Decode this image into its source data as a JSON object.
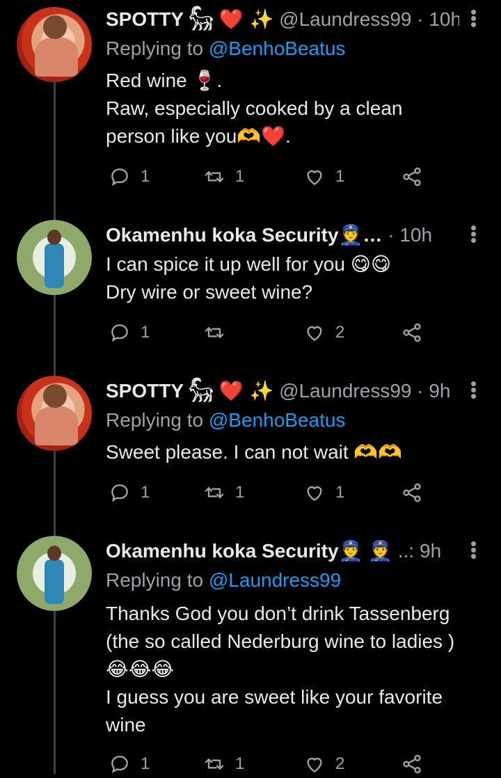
{
  "tweets": [
    {
      "name": "SPOTTY 𓃵",
      "name_emoji": "❤️ ✨",
      "handle": "@Laundress99",
      "time": "10h",
      "replying_label": "Replying to",
      "replying_to": "@BenhoBeatus",
      "lines": [
        "Red wine 🍷.",
        "Raw, especially cooked by a clean",
        "person like you🫶❤️."
      ],
      "replies": "1",
      "retweets": "1",
      "likes": "1"
    },
    {
      "name": "Okamenhu koka Security👮…",
      "handle": "",
      "time": "10h",
      "lines": [
        "I can spice it up well for you 😋😋",
        "Dry wire or sweet wine?"
      ],
      "replies": "1",
      "retweets": "",
      "likes": "2"
    },
    {
      "name": "SPOTTY 𓃵",
      "name_emoji": "❤️ ✨",
      "handle": "@Laundress99",
      "time": "9h",
      "replying_label": "Replying to",
      "replying_to": "@BenhoBeatus",
      "lines": [
        "Sweet please. I can not wait 🫶🫶"
      ],
      "replies": "1",
      "retweets": "1",
      "likes": "1"
    },
    {
      "name": "Okamenhu koka Security👮 👮",
      "handle": "..:",
      "time": "9h",
      "replying_label": "Replying to",
      "replying_to": "@Laundress99",
      "lines": [
        "Thanks God you don’t drink Tassenberg",
        "(the so called Nederburg wine to ladies )",
        "😂😂😂",
        "I guess you are sweet like your favorite",
        "wine"
      ],
      "replies": "1",
      "retweets": "1",
      "likes": "2"
    }
  ],
  "colors": {
    "background": "#000000",
    "text": "#e7e9ea",
    "muted": "#9ca3a8",
    "link": "#1d9bf0"
  }
}
